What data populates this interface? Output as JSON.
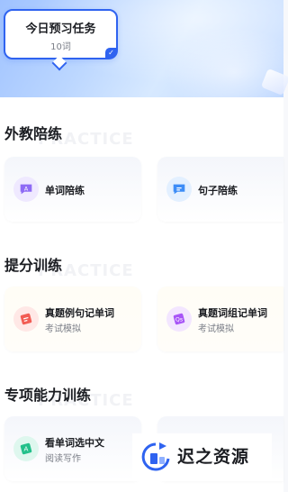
{
  "task": {
    "title": "今日预习任务",
    "count": "10词"
  },
  "sections": [
    {
      "title": "外教陪练",
      "watermark": "PRACTICE",
      "cards": [
        {
          "title": "单词陪练",
          "subtitle": "",
          "icon": "word-practice-icon"
        },
        {
          "title": "句子陪练",
          "subtitle": "",
          "icon": "sentence-practice-icon"
        }
      ]
    },
    {
      "title": "提分训练",
      "watermark": "PRACTICE",
      "cards": [
        {
          "title": "真题例句记单词",
          "subtitle": "考试模拟",
          "icon": "example-sentence-icon"
        },
        {
          "title": "真题词组记单词",
          "subtitle": "考试模拟",
          "icon": "phrase-icon"
        }
      ]
    },
    {
      "title": "专项能力训练",
      "watermark": "PRACTICE",
      "cards": [
        {
          "title": "看单词选中文",
          "subtitle": "阅读写作",
          "icon": "choose-chinese-icon"
        }
      ]
    }
  ],
  "brand": {
    "text": "迟之资源"
  },
  "colors": {
    "accent": "#2f63f0",
    "icon_purple": "#8e6bf5",
    "icon_blue": "#3d8df7",
    "icon_red": "#f25d54",
    "icon_violet": "#a855f7",
    "icon_green": "#22c08a"
  }
}
